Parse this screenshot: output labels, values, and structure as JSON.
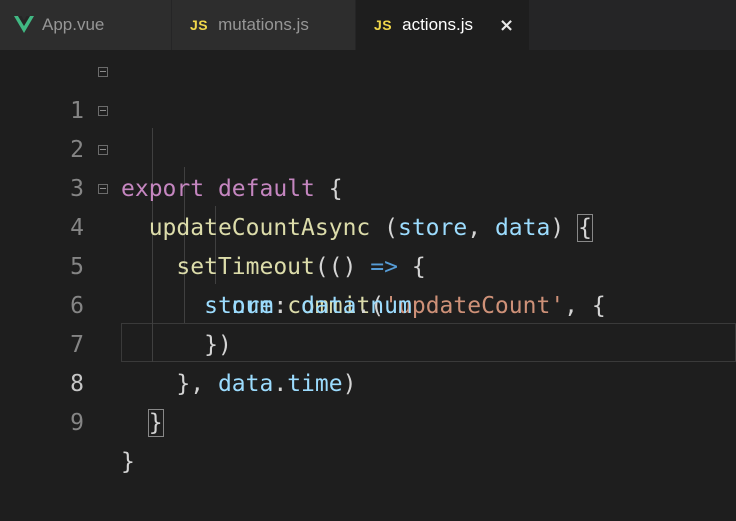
{
  "tabs": [
    {
      "label": "App.vue",
      "icon": "vue-icon",
      "active": false
    },
    {
      "label": "mutations.js",
      "icon": "JS",
      "active": false
    },
    {
      "label": "actions.js",
      "icon": "JS",
      "active": true,
      "close": "×"
    }
  ],
  "editor": {
    "current_line": 8,
    "lines": [
      {
        "num": "1"
      },
      {
        "num": "2"
      },
      {
        "num": "3"
      },
      {
        "num": "4"
      },
      {
        "num": "5"
      },
      {
        "num": "6"
      },
      {
        "num": "7"
      },
      {
        "num": "8"
      },
      {
        "num": "9"
      }
    ],
    "tokens": {
      "l1": [
        "export",
        "default",
        "{"
      ],
      "l2": [
        "updateCountAsync",
        "(",
        "store",
        ",",
        "data",
        ")",
        "{"
      ],
      "l3": [
        "setTimeout",
        "(() ",
        "=>",
        "{"
      ],
      "l4": [
        "store",
        ".",
        "commit",
        "(",
        "'updateCount'",
        ", {"
      ],
      "l5": [
        "num",
        ":",
        "data",
        ".",
        "num"
      ],
      "l6": [
        "})"
      ],
      "l7": [
        "},",
        "data",
        ".",
        "time",
        ")"
      ],
      "l8": [
        "}"
      ],
      "l9": [
        "}"
      ]
    }
  },
  "colors": {
    "background": "#1e1e1e",
    "keyword": "#c586c0",
    "function": "#dcdcaa",
    "variable": "#9cdcfe",
    "string": "#ce9178",
    "arrow": "#569cd6",
    "js_badge": "#f0d74a",
    "vue": "#41b883"
  }
}
